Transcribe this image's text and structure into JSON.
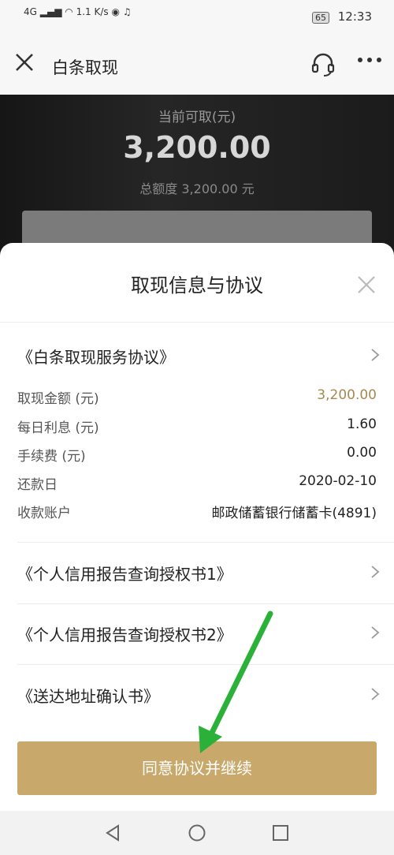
{
  "status_bar": {
    "network": "4G",
    "speed_top": "1.1",
    "speed_unit": "K/s",
    "battery": "65",
    "time": "12:33"
  },
  "nav": {
    "title": "白条取现"
  },
  "hero": {
    "label": "当前可取(元)",
    "amount": "3,200.00",
    "total": "总额度 3,200.00 元"
  },
  "sheet": {
    "title": "取现信息与协议",
    "service_agreement": "《白条取现服务协议》",
    "details": [
      {
        "label": "取现金额 (元)",
        "value": "3,200.00"
      },
      {
        "label": "每日利息 (元)",
        "value": "1.60"
      },
      {
        "label": "手续费 (元)",
        "value": "0.00"
      },
      {
        "label": "还款日",
        "value": "2020-02-10"
      },
      {
        "label": "收款账户",
        "value": "邮政储蓄银行储蓄卡(4891)"
      }
    ],
    "agreements": [
      "《个人信用报告查询授权书1》",
      "《个人信用报告查询授权书2》",
      "《送达地址确认书》"
    ],
    "confirm_button": "同意协议并继续"
  },
  "colors": {
    "accent": "#c8a96b",
    "amount_gold": "#a5894f",
    "arrow_green": "#2bb03a"
  }
}
